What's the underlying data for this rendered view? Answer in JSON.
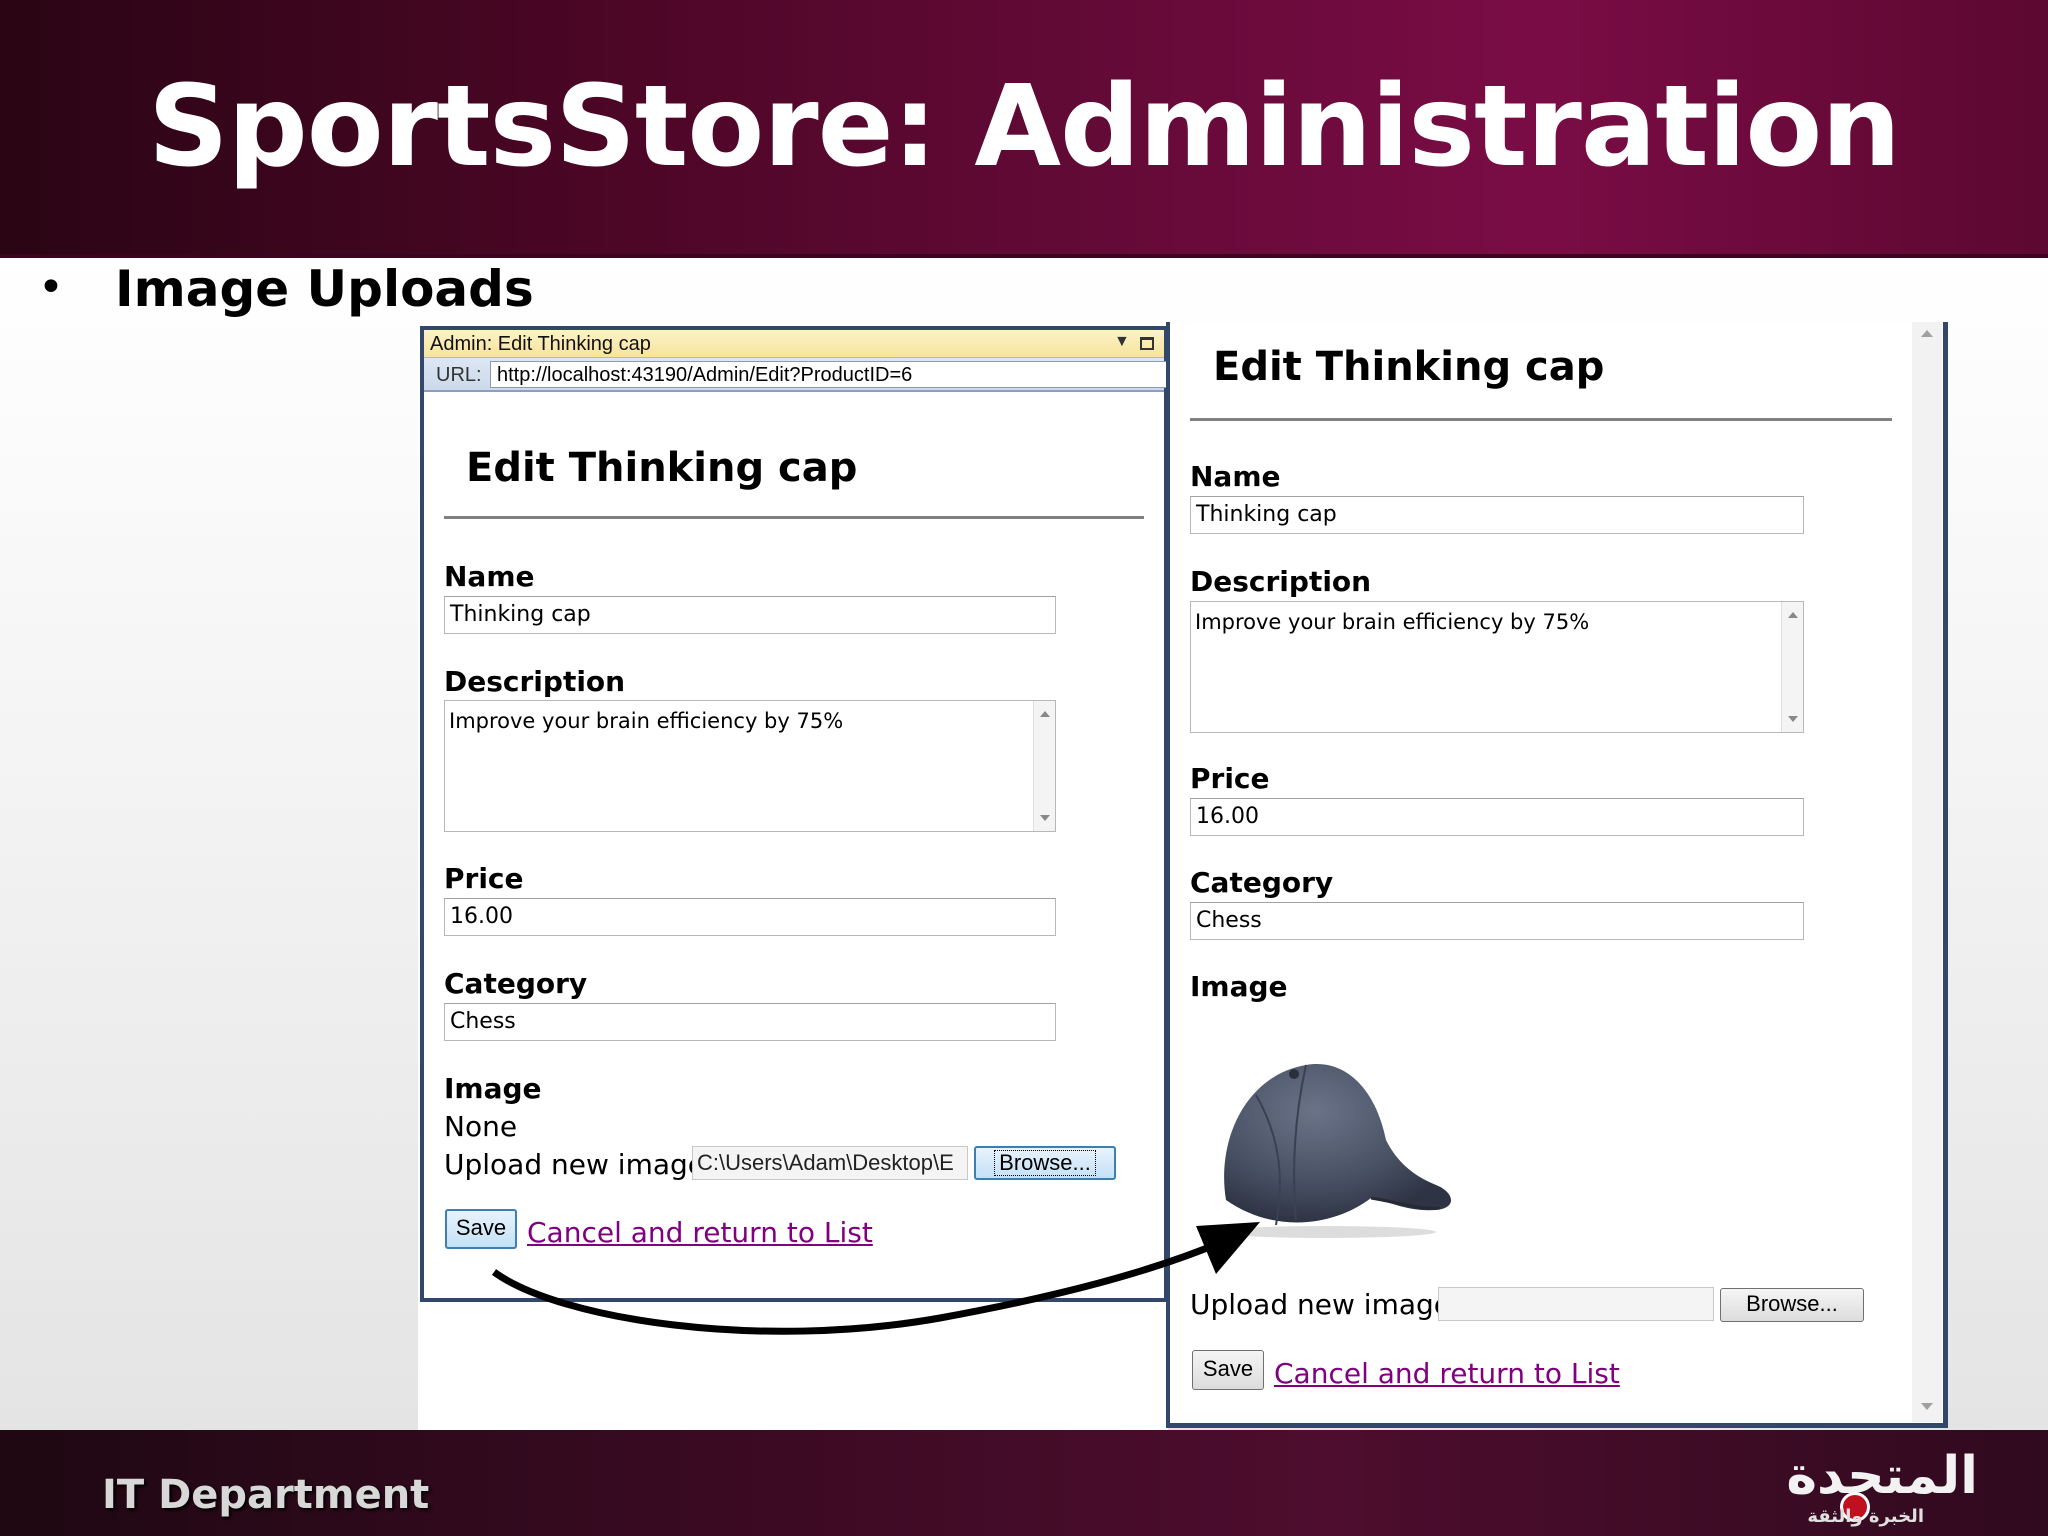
{
  "slide": {
    "title": "SportsStore: Administration",
    "bullet": "•",
    "bullet_text": "Image Uploads",
    "footer_left": "IT Department",
    "footer_logo_main": "المتحدة",
    "footer_logo_sub": "الخبرة والثقة"
  },
  "left_window": {
    "title": "Admin: Edit Thinking cap",
    "url_label": "URL:",
    "url": "http://localhost:43190/Admin/Edit?ProductID=6",
    "heading": "Edit Thinking cap",
    "name_label": "Name",
    "name_value": "Thinking cap",
    "description_label": "Description",
    "description_value": "Improve your brain efficiency by 75%",
    "price_label": "Price",
    "price_value": "16.00",
    "category_label": "Category",
    "category_value": "Chess",
    "image_label": "Image",
    "image_value": "None",
    "upload_label": "Upload new image:",
    "upload_path": "C:\\Users\\Adam\\Desktop\\E",
    "browse_label": "Browse...",
    "save_label": "Save",
    "cancel_label": "Cancel and return to List"
  },
  "right_window": {
    "heading": "Edit Thinking cap",
    "name_label": "Name",
    "name_value": "Thinking cap",
    "description_label": "Description",
    "description_value": "Improve your brain efficiency by 75%",
    "price_label": "Price",
    "price_value": "16.00",
    "category_label": "Category",
    "category_value": "Chess",
    "image_label": "Image",
    "upload_label": "Upload new image:",
    "upload_path": "",
    "browse_label": "Browse...",
    "save_label": "Save",
    "cancel_label": "Cancel and return to List"
  },
  "colors": {
    "header_accent": "#650a38",
    "window_border": "#33476a",
    "visited_link": "#800080",
    "cap": "#4a5366"
  }
}
